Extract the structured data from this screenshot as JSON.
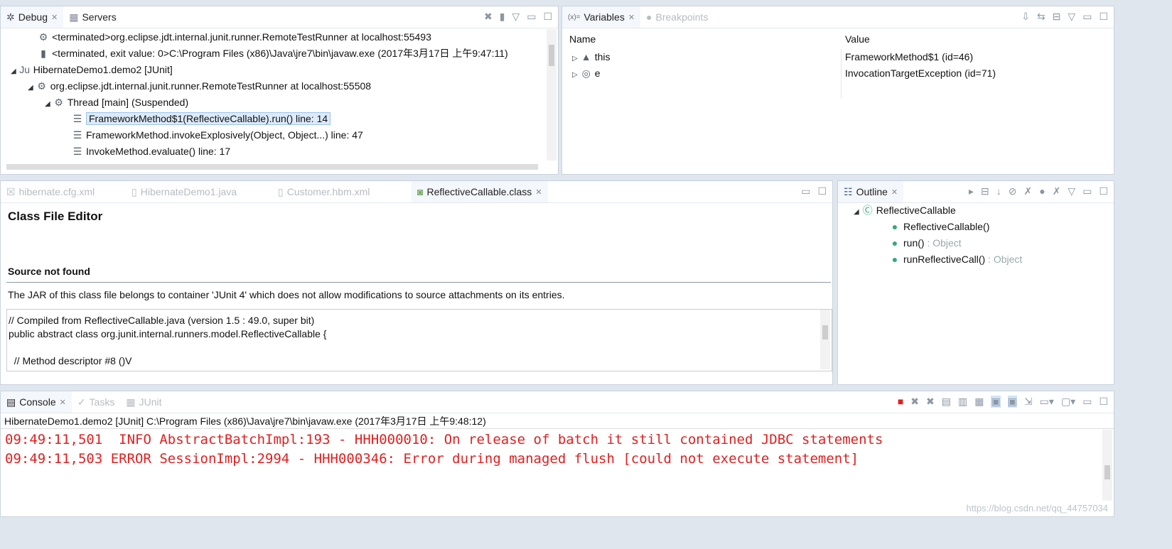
{
  "debug": {
    "tabs": [
      {
        "label": "Debug",
        "icon": "bug-icon"
      },
      {
        "label": "Servers",
        "icon": "servers-icon"
      }
    ],
    "tree": [
      {
        "text": "<terminated>org.eclipse.jdt.internal.junit.runner.RemoteTestRunner at localhost:55493",
        "icon": "terminated-launch-icon",
        "indent": 1
      },
      {
        "text": "<terminated, exit value: 0>C:\\Program Files (x86)\\Java\\jre7\\bin\\javaw.exe (2017年3月17日 上午9:47:11)",
        "icon": "process-icon",
        "indent": 1
      },
      {
        "text": "HibernateDemo1.demo2 [JUnit]",
        "icon": "junit-icon",
        "indent": 0,
        "expanded": true
      },
      {
        "text": "org.eclipse.jdt.internal.junit.runner.RemoteTestRunner at localhost:55508",
        "icon": "debug-target-icon",
        "indent": 1,
        "expanded": true
      },
      {
        "text": "Thread [main] (Suspended)",
        "icon": "thread-suspended-icon",
        "indent": 2,
        "expanded": true
      },
      {
        "text": "FrameworkMethod$1(ReflectiveCallable).run() line: 14",
        "icon": "stack-frame-icon",
        "indent": 3,
        "selected": true
      },
      {
        "text": "FrameworkMethod.invokeExplosively(Object, Object...) line: 47",
        "icon": "stack-frame-icon",
        "indent": 3
      },
      {
        "text": "InvokeMethod.evaluate() line: 17",
        "icon": "stack-frame-icon",
        "indent": 3
      }
    ]
  },
  "variables": {
    "tabs": [
      {
        "label": "Variables"
      },
      {
        "label": "Breakpoints"
      }
    ],
    "headers": [
      "Name",
      "Value"
    ],
    "rows": [
      {
        "name": "this",
        "value": "FrameworkMethod$1  (id=46)"
      },
      {
        "name": "e",
        "value": "InvocationTargetException  (id=71)"
      }
    ]
  },
  "editor": {
    "tabs": [
      {
        "label": "hibernate.cfg.xml"
      },
      {
        "label": "HibernateDemo1.java"
      },
      {
        "label": "Customer.hbm.xml"
      },
      {
        "label": "ReflectiveCallable.class",
        "active": true
      }
    ],
    "title": "Class File Editor",
    "subtitle": "Source not found",
    "message": "The JAR of this class file belongs to container 'JUnit 4' which does not allow modifications to source attachments on its entries.",
    "code": [
      "// Compiled from ReflectiveCallable.java (version 1.5 : 49.0, super bit)",
      "public abstract class org.junit.internal.runners.model.ReflectiveCallable {",
      "",
      "  // Method descriptor #8 ()V"
    ]
  },
  "outline": {
    "tab": "Outline",
    "items": [
      {
        "name": "ReflectiveCallable",
        "type": "",
        "indent": 0
      },
      {
        "name": "ReflectiveCallable()",
        "type": "",
        "indent": 1
      },
      {
        "name": "run()",
        "type": " : Object",
        "indent": 1
      },
      {
        "name": "runReflectiveCall()",
        "type": " : Object",
        "indent": 1
      }
    ]
  },
  "console": {
    "tabs": [
      {
        "label": "Console"
      },
      {
        "label": "Tasks"
      },
      {
        "label": "JUnit"
      }
    ],
    "process": "HibernateDemo1.demo2 [JUnit] C:\\Program Files (x86)\\Java\\jre7\\bin\\javaw.exe (2017年3月17日 上午9:48:12)",
    "lines": [
      "09:49:11,501  INFO AbstractBatchImpl:193 - HHH000010: On release of batch it still contained JDBC statements",
      "09:49:11,503 ERROR SessionImpl:2994 - HHH000346: Error during managed flush [could not execute statement]"
    ],
    "error_color": "#e02020"
  },
  "watermark": "https://blog.csdn.net/qq_44757034"
}
